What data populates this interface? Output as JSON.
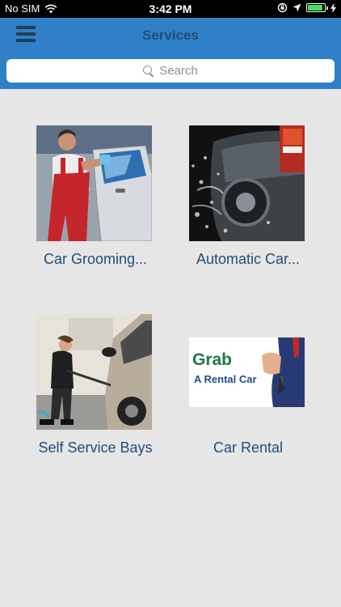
{
  "status_bar": {
    "carrier": "No SIM",
    "time": "3:42 PM",
    "battery_level": 0.9
  },
  "nav": {
    "title": "Services",
    "menu_icon": "hamburger-menu-icon"
  },
  "search": {
    "placeholder": "Search"
  },
  "services": [
    {
      "label": "Car Grooming...",
      "image": "car-grooming-photo"
    },
    {
      "label": "Automatic Car...",
      "image": "automatic-car-wash-photo"
    },
    {
      "label": "Self Service Bays",
      "image": "self-service-bay-photo"
    },
    {
      "label": "Car Rental",
      "image": "car-rental-photo",
      "image_text": [
        "Grab",
        "A Rental Car"
      ]
    }
  ],
  "colors": {
    "nav_background": "#2f80c6",
    "title": "#244d75",
    "label": "#234d77",
    "page_background": "#e6e6e6"
  }
}
